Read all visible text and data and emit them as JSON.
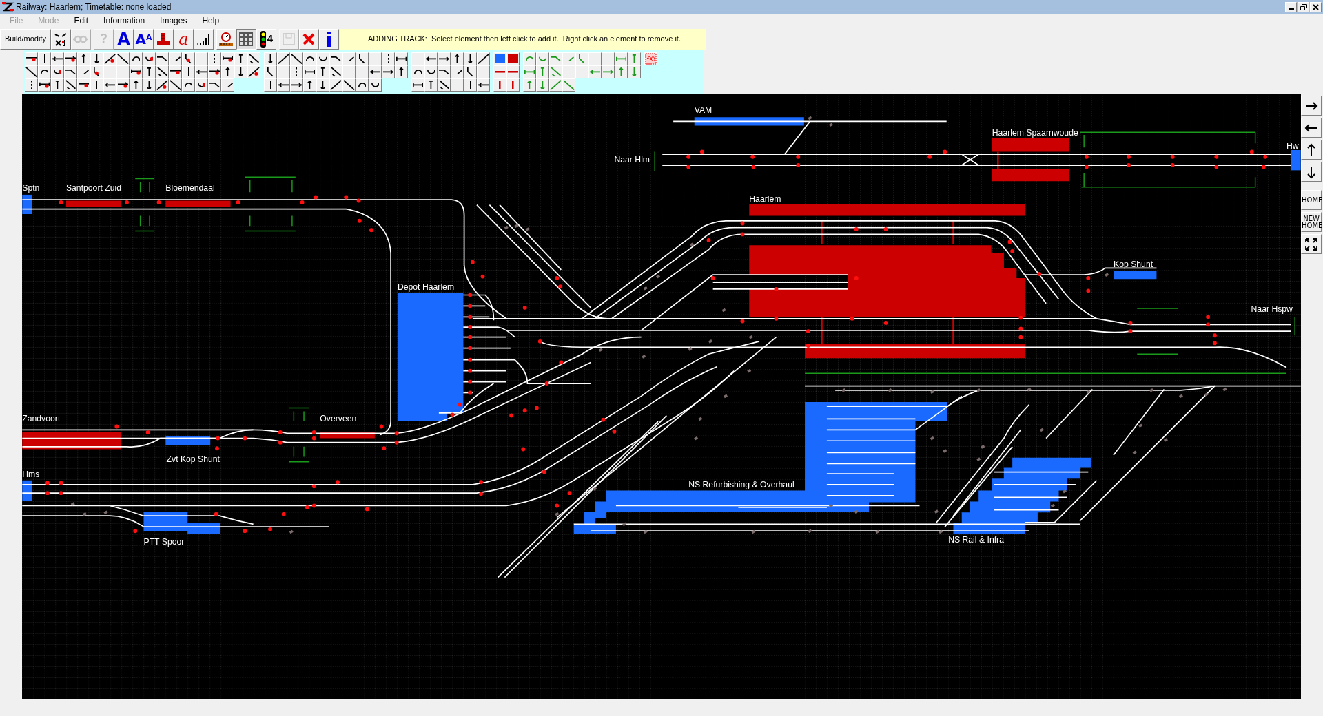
{
  "window": {
    "title": "Railway: Haarlem; Timetable: none loaded"
  },
  "menu": [
    {
      "label": "File",
      "disabled": true
    },
    {
      "label": "Mode",
      "disabled": true
    },
    {
      "label": "Edit",
      "disabled": false
    },
    {
      "label": "Information",
      "disabled": false
    },
    {
      "label": "Images",
      "disabled": false
    },
    {
      "label": "Help",
      "disabled": false
    }
  ],
  "toolbar": {
    "mode_button": "Build/modify",
    "buttons": [
      {
        "kind": "track-tools",
        "disabled": false,
        "selected": false
      },
      {
        "kind": "link",
        "disabled": true,
        "selected": false
      },
      {
        "kind": "question",
        "label": "?",
        "disabled": true,
        "selected": false
      },
      {
        "kind": "text",
        "label": "A",
        "disabled": false,
        "selected": false
      },
      {
        "kind": "move-text",
        "label": "A",
        "superscript": "A",
        "disabled": false,
        "selected": false
      },
      {
        "kind": "platform",
        "disabled": false,
        "selected": false
      },
      {
        "kind": "script",
        "label": "a",
        "disabled": false,
        "selected": false
      },
      {
        "kind": "signal-bars",
        "disabled": false,
        "selected": false
      },
      {
        "kind": "gauge",
        "disabled": false,
        "selected": false
      },
      {
        "kind": "grid",
        "disabled": false,
        "selected": true
      },
      {
        "kind": "signal",
        "label": "4",
        "disabled": false,
        "selected": false
      },
      {
        "kind": "save",
        "disabled": true,
        "selected": false
      },
      {
        "kind": "delete",
        "disabled": false,
        "selected": false
      },
      {
        "kind": "info",
        "disabled": false,
        "selected": false
      }
    ],
    "info_bar": "ADDING TRACK:  Select element then left click to add it.  Right click an element to remove it."
  },
  "layout_labels": [
    "VAM",
    "Naar Hlm",
    "Haarlem Spaarnwoude",
    "Hw",
    "Sptn",
    "Santpoort Zuid",
    "Bloemendaal",
    "Haarlem",
    "Depot Haarlem",
    "Kop Shunt",
    "Naar Hspw",
    "Zandvoort",
    "Overveen",
    "Zvt Kop Shunt",
    "Hms",
    "NS Refurbishing & Overhaul",
    "PTT Spoor",
    "NS Rail & Infra"
  ],
  "navigation": [
    {
      "kind": "right"
    },
    {
      "kind": "left"
    },
    {
      "kind": "up"
    },
    {
      "kind": "down"
    },
    {
      "kind": "text",
      "label": "HOME"
    },
    {
      "kind": "text",
      "label": "NEW HOME"
    },
    {
      "kind": "fit"
    }
  ]
}
